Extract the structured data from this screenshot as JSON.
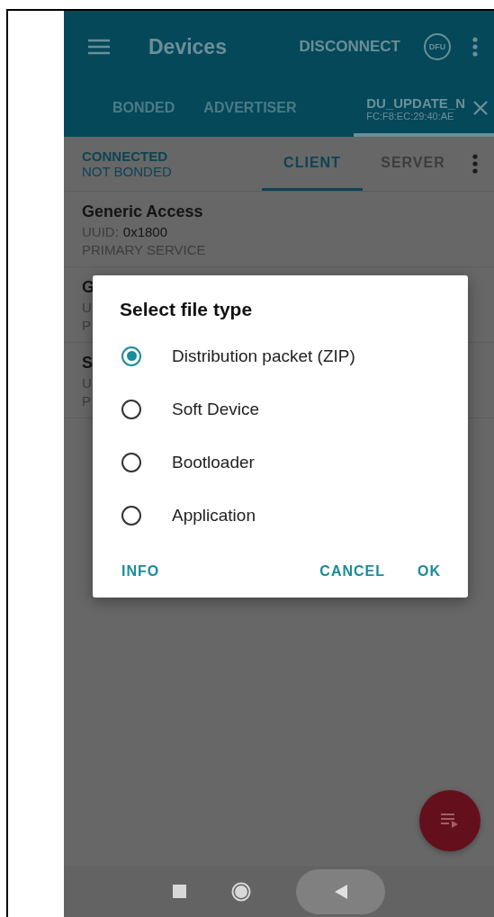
{
  "toolbar": {
    "title": "Devices",
    "action": "DISCONNECT",
    "dfu_label": "DFU"
  },
  "device_tabs": [
    {
      "label": "BONDED",
      "selected": false
    },
    {
      "label": "ADVERTISER",
      "selected": false
    },
    {
      "label": "DU_UPDATE_N",
      "address": "FC:F8:EC:29:40:AE",
      "selected": true
    }
  ],
  "connection": {
    "status": "CONNECTED",
    "bond": "NOT BONDED"
  },
  "sub_tabs": [
    {
      "label": "CLIENT",
      "selected": true
    },
    {
      "label": "SERVER",
      "selected": false
    }
  ],
  "services": [
    {
      "name": "Generic Access",
      "uuid_label": "UUID:",
      "uuid": "0x1800",
      "type": "PRIMARY SERVICE"
    },
    {
      "name": "G",
      "uuid_label": "U",
      "type": "P"
    },
    {
      "name": "S",
      "uuid_label": "U",
      "type": "P"
    }
  ],
  "dialog": {
    "title": "Select file type",
    "options": [
      {
        "label": "Distribution packet (ZIP)",
        "selected": true
      },
      {
        "label": "Soft Device",
        "selected": false
      },
      {
        "label": "Bootloader",
        "selected": false
      },
      {
        "label": "Application",
        "selected": false
      }
    ],
    "buttons": [
      "INFO",
      "CANCEL",
      "OK"
    ]
  }
}
